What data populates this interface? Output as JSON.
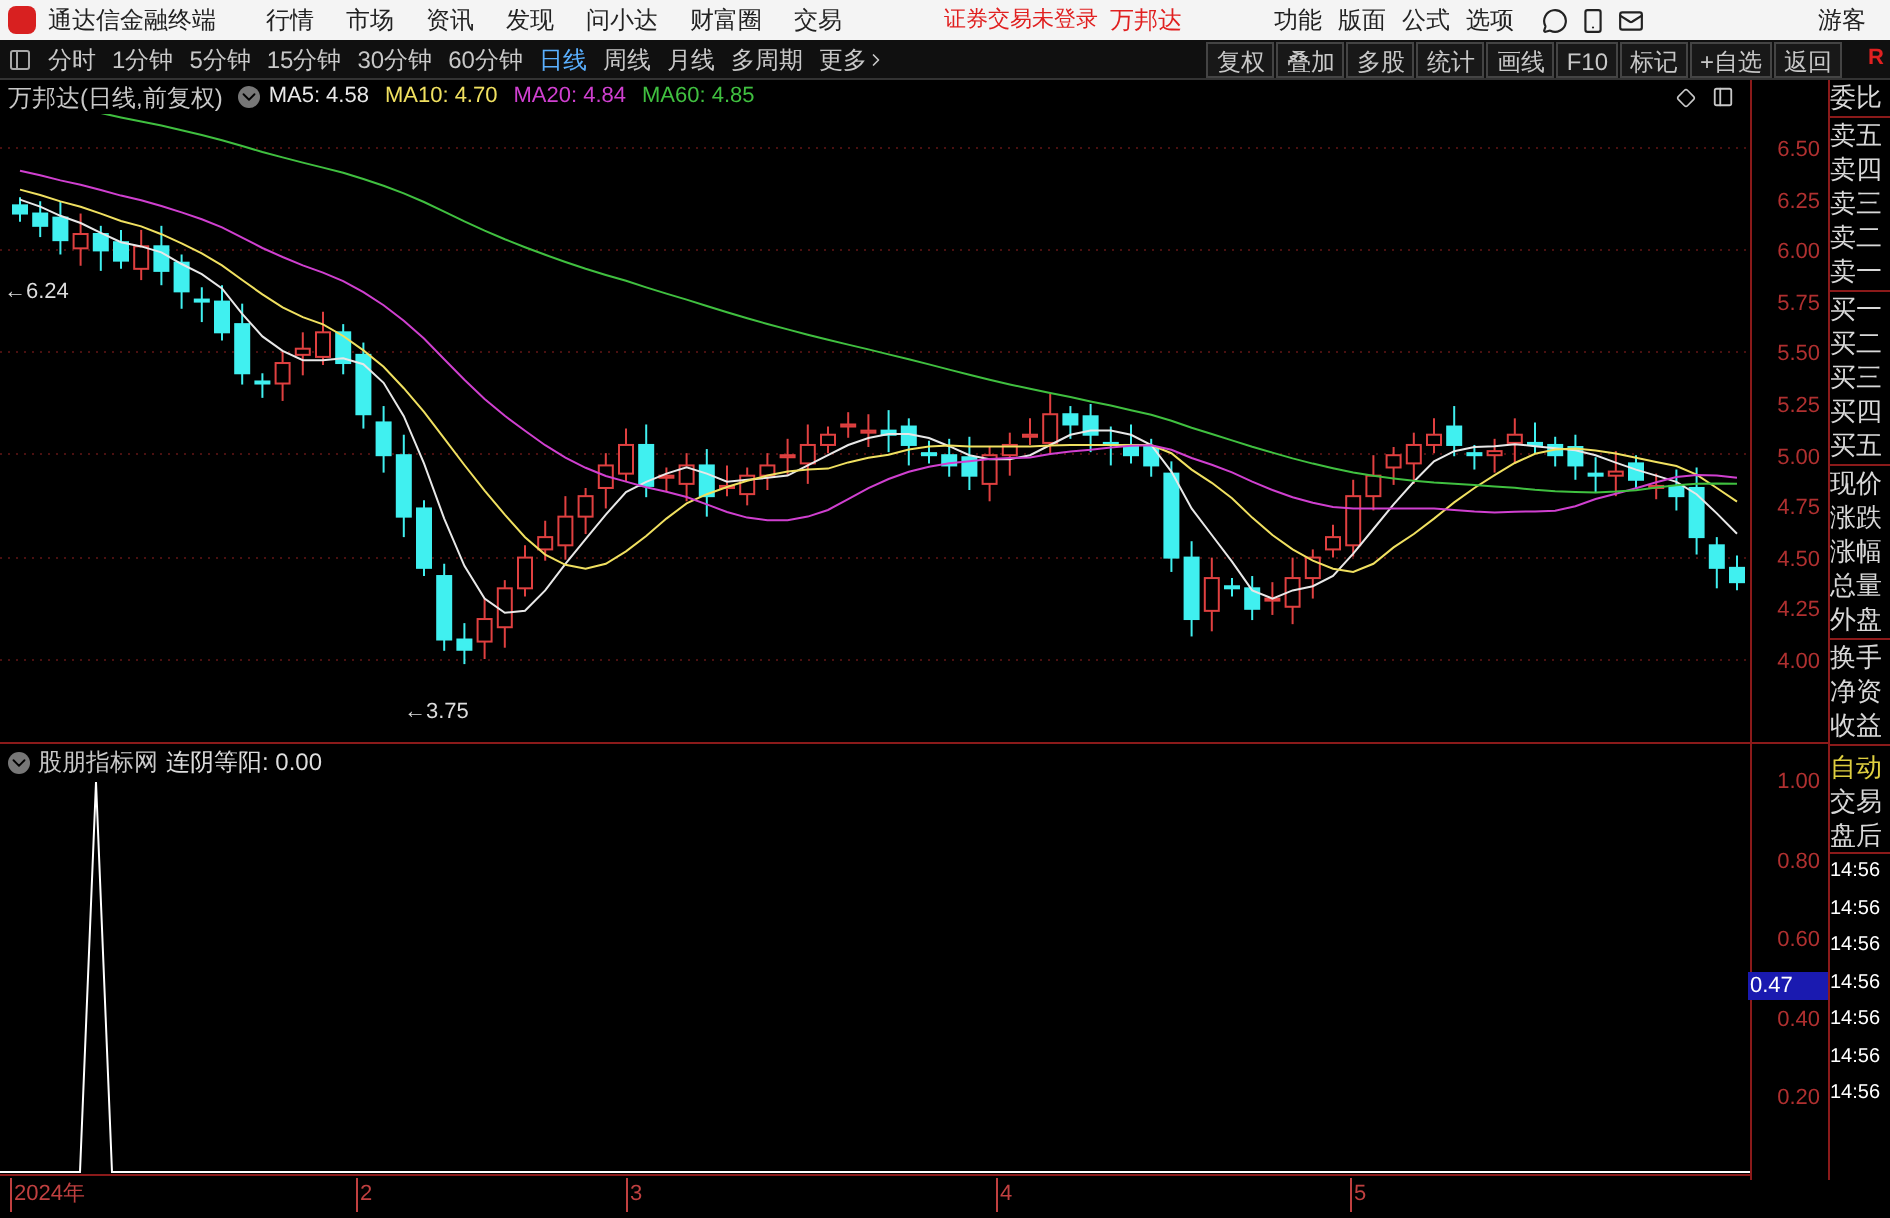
{
  "title_bar": {
    "app_name": "通达信金融终端",
    "menu": [
      "行情",
      "市场",
      "资讯",
      "发现",
      "问小达",
      "财富圈",
      "交易"
    ],
    "notice": "证券交易未登录",
    "stock": "万邦达",
    "tools": [
      "功能",
      "版面",
      "公式",
      "选项"
    ],
    "user": "游客"
  },
  "toolbar": {
    "periods": [
      {
        "label": "分时",
        "selected": false
      },
      {
        "label": "1分钟",
        "selected": false
      },
      {
        "label": "5分钟",
        "selected": false
      },
      {
        "label": "15分钟",
        "selected": false
      },
      {
        "label": "30分钟",
        "selected": false
      },
      {
        "label": "60分钟",
        "selected": false
      },
      {
        "label": "日线",
        "selected": true
      },
      {
        "label": "周线",
        "selected": false
      },
      {
        "label": "月线",
        "selected": false
      },
      {
        "label": "多周期",
        "selected": false
      },
      {
        "label": "更多",
        "selected": false
      }
    ],
    "actions": [
      "复权",
      "叠加",
      "多股",
      "统计",
      "画线",
      "F10",
      "标记",
      "+自选",
      "返回"
    ],
    "badge": "R"
  },
  "chart": {
    "title": "万邦达(日线,前复权)",
    "ma": [
      {
        "label": "MA5: 4.58",
        "color": "#e8e8e8"
      },
      {
        "label": "MA10: 4.70",
        "color": "#f0e060"
      },
      {
        "label": "MA20: 4.84",
        "color": "#d040d0"
      },
      {
        "label": "MA60: 4.85",
        "color": "#40c040"
      }
    ],
    "y_ticks": [
      "6.50",
      "6.25",
      "6.00",
      "5.75",
      "5.50",
      "5.25",
      "5.00",
      "4.75",
      "4.50",
      "4.25",
      "4.00"
    ],
    "high_label": "←6.24",
    "low_label": "←3.75"
  },
  "indicator": {
    "source": "股朋指标网",
    "label": "连阴等阳: 0.00",
    "y_ticks": [
      "1.00",
      "0.80",
      "0.60",
      "0.40",
      "0.20"
    ],
    "cursor_value": "0.47"
  },
  "x_axis": [
    "2024年",
    "2",
    "3",
    "4",
    "5"
  ],
  "quote_panel": {
    "groups": [
      [
        "委比"
      ],
      [
        "卖五",
        "卖四",
        "卖三",
        "卖二",
        "卖一"
      ],
      [
        "买一",
        "买二",
        "买三",
        "买四",
        "买五"
      ],
      [
        "现价",
        "涨跌",
        "涨幅",
        "总量",
        "外盘"
      ],
      [
        "换手",
        "净资",
        "收益"
      ]
    ],
    "mode": "自动",
    "after": [
      "交易",
      "盘后"
    ],
    "times": [
      "14:56",
      "14:56",
      "14:56",
      "14:56",
      "14:56",
      "14:56",
      "14:56"
    ]
  }
}
